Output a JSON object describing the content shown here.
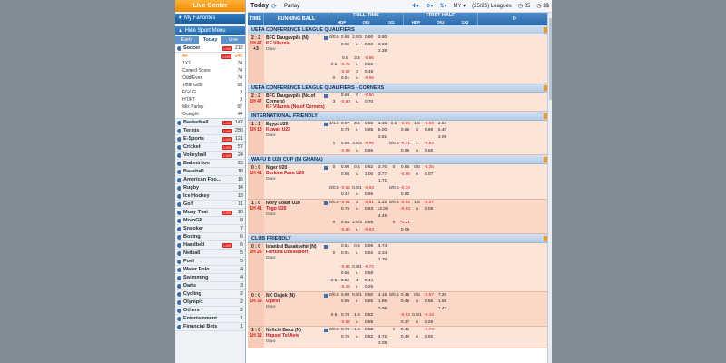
{
  "left": {
    "live_center": "Live Center",
    "my_favorites": "My Favorites",
    "hide_sport_menu": "Hide Sport Menu",
    "tabs": [
      "Early",
      "Today",
      "Live"
    ],
    "soccer": {
      "name": "Soccer",
      "badge": "LIVE",
      "count": "212"
    },
    "soccer_sub": [
      {
        "name": "All",
        "badge": "LIVE",
        "count": "146"
      },
      {
        "name": "1X2",
        "count": "74"
      },
      {
        "name": "Correct Score",
        "count": "74"
      },
      {
        "name": "Odd/Even",
        "count": "74"
      },
      {
        "name": "Total Goal",
        "count": "68"
      },
      {
        "name": "FG/LG",
        "count": "0"
      },
      {
        "name": "HT/FT",
        "count": "0"
      },
      {
        "name": "Mix Parlay",
        "count": "67"
      },
      {
        "name": "Outright",
        "count": "44"
      }
    ],
    "sports": [
      {
        "name": "Basketball",
        "badge": "LIVE",
        "count": "147"
      },
      {
        "name": "Tennis",
        "badge": "LIVE",
        "count": "256"
      },
      {
        "name": "E-Sports",
        "badge": "LIVE",
        "count": "121"
      },
      {
        "name": "Cricket",
        "badge": "LIVE",
        "count": "57"
      },
      {
        "name": "Volleyball",
        "badge": "LIVE",
        "count": "24"
      },
      {
        "name": "Badminton",
        "count": "23"
      },
      {
        "name": "Baseball",
        "count": "18"
      },
      {
        "name": "American Foo...",
        "count": "16"
      },
      {
        "name": "Rugby",
        "count": "14"
      },
      {
        "name": "Ice Hockey",
        "count": "13"
      },
      {
        "name": "Golf",
        "count": "11"
      },
      {
        "name": "Muay Thai",
        "badge": "LIVE",
        "count": "10"
      },
      {
        "name": "MotoGP",
        "count": "8"
      },
      {
        "name": "Snooker",
        "count": "7"
      },
      {
        "name": "Boxing",
        "count": "6"
      },
      {
        "name": "Handball",
        "badge": "LIVE",
        "count": "6"
      },
      {
        "name": "Netball",
        "count": "5"
      },
      {
        "name": "Pool",
        "count": "5"
      },
      {
        "name": "Water Polo",
        "count": "4"
      },
      {
        "name": "Swimming",
        "count": "4"
      },
      {
        "name": "Darts",
        "count": "3"
      },
      {
        "name": "Cycling",
        "count": "2"
      },
      {
        "name": "Olympic",
        "count": "2"
      },
      {
        "name": "Others",
        "count": "2"
      },
      {
        "name": "Entertainment",
        "count": "1"
      },
      {
        "name": "Financial Bets",
        "count": "1"
      }
    ]
  },
  "toolbar": {
    "today": "Today",
    "parlay": "Parlay",
    "my": "MY",
    "leagues": "(25/25) Leagues",
    "a": "85",
    "b": "$$"
  },
  "head": {
    "time": "TIME",
    "running_ball": "RUNNING BALL",
    "full_time": "FULL TIME",
    "first_half": "FIRST HALF",
    "sub": [
      "HDP",
      "O/U",
      "1X2",
      "HDP",
      "O/U",
      "1X2"
    ]
  },
  "leagues": [
    {
      "name": "UEFA CONFERENCE LEAGUE QUALIFIERS",
      "matches": [
        {
          "score": "2 : 2",
          "time": "1H 47",
          "extra": "+3",
          "home": "BFC Daugavpils (N)",
          "away": "KF Vllaznia",
          "draw": "Draw",
          "lines": [
            [
              "0/0.5",
              "0.88",
              "2.5/3",
              "0.90",
              "3.80",
              "",
              "",
              "",
              "",
              ""
            ],
            [
              "",
              "0.96",
              "u",
              "0.92",
              "2.28",
              "",
              "",
              "",
              "",
              ""
            ],
            [
              "",
              "",
              "",
              "",
              "2.38",
              "",
              "",
              "",
              "",
              ""
            ],
            [
              "",
              "0.5",
              "3.5",
              "-0.86",
              "",
              "",
              "",
              "",
              "",
              ""
            ],
            [
              "0.5",
              "-0.75",
              "u",
              "0.66",
              "",
              "",
              "",
              "",
              "",
              ""
            ],
            [
              "",
              "-0.67",
              "3",
              "0.48",
              "",
              "",
              "",
              "",
              "",
              ""
            ],
            [
              "0",
              "0.51",
              "u",
              "-0.66",
              "",
              "",
              "",
              "",
              "",
              ""
            ]
          ]
        }
      ]
    },
    {
      "name": "UEFA CONFERENCE LEAGUE QUALIFIERS - CORNERS",
      "matches": [
        {
          "score": "2 : 2",
          "time": "1H 47",
          "extra": "",
          "home": "BFC Daugavpils (No.of Corners)",
          "away": "KF Vllaznia (No.of Corners)",
          "draw": "",
          "lines": [
            [
              "",
              "0.68",
              "9",
              "-0.90",
              "",
              "",
              "",
              "",
              "",
              ""
            ],
            [
              "3",
              "-0.90",
              "u",
              "0.70",
              "",
              "",
              "",
              "",
              "",
              ""
            ]
          ]
        }
      ]
    },
    {
      "name": "INTERNATIONAL FRIENDLY",
      "matches": [
        {
          "score": "1 : 1",
          "time": "1H 13",
          "extra": "",
          "home": "Egypt U20",
          "away": "Kuwait U23",
          "draw": "Draw",
          "lines": [
            [
              "1/1.5",
              "0.97",
              "3.5",
              "0.85",
              "1.38",
              "0.5",
              "-0.96",
              "1.5",
              "-0.99",
              "2.84"
            ],
            [
              "",
              "0.73",
              "u",
              "0.85",
              "6.00",
              "",
              "0.66",
              "u",
              "0.89",
              "5.40"
            ],
            [
              "",
              "",
              "",
              "",
              "3.81",
              "",
              "",
              "",
              "",
              "2.09"
            ],
            [
              "1",
              "0.69",
              "3.5/3",
              "-0.95",
              "",
              "0/0.5",
              "-0.71",
              "1",
              "-0.84",
              ""
            ],
            [
              "",
              "-0.99",
              "u",
              "0.65",
              "",
              "",
              "0.95",
              "u",
              "0.65",
              ""
            ]
          ]
        }
      ]
    },
    {
      "name": "WAFU B U20 CUP (IN GHANA)",
      "matches": [
        {
          "score": "0 : 0",
          "time": "1H 41",
          "extra": "",
          "home": "Niger U20",
          "away": "Burkina Faso U20",
          "draw": "Draw",
          "lines": [
            [
              "0",
              "0.90",
              "0.5",
              "0.82",
              "3.70",
              "0",
              "0.65",
              "0.5",
              "-0.25",
              ""
            ],
            [
              "",
              "0.94",
              "u",
              "1.00",
              "3.77",
              "",
              "-0.96",
              "u",
              "0.07",
              ""
            ],
            [
              "",
              "",
              "",
              "",
              "1.71",
              "",
              "",
              "",
              "",
              ""
            ],
            [
              "0/0.5",
              "-0.52",
              "0.5/1",
              "-0.83",
              "",
              "0/0.5",
              "-0.30",
              "",
              "",
              ""
            ],
            [
              "",
              "0.42",
              "u",
              "0.65",
              "",
              "",
              "0.82",
              "",
              "",
              ""
            ]
          ]
        },
        {
          "score": "1 : 0",
          "time": "1H 41",
          "extra": "",
          "home": "Ivory Coast U20",
          "away": "Togo U20",
          "draw": "Draw",
          "lines": [
            [
              "0/0.5",
              "-0.91",
              "2",
              "-0.81",
              "1.22",
              "0/0.5",
              "-0.82",
              "1.5",
              "-0.27",
              ""
            ],
            [
              "",
              "0.75",
              "u",
              "0.63",
              "13.00",
              "",
              "-0.83",
              "u",
              "0.09",
              ""
            ],
            [
              "",
              "",
              "",
              "",
              "4.45",
              "",
              "",
              "",
              "",
              ""
            ],
            [
              "0",
              "0.64",
              "2.5/3",
              "0.65",
              "",
              "0",
              "-0.21",
              "",
              "",
              ""
            ],
            [
              "",
              "-0.80",
              "u",
              "-0.83",
              "",
              "",
              "0.05",
              "",
              "",
              ""
            ]
          ]
        }
      ]
    },
    {
      "name": "CLUB FRIENDLY",
      "matches": [
        {
          "score": "0 : 0",
          "time": "2H 26",
          "extra": "",
          "home": "Istanbul Basaksehir (N)",
          "away": "Fortuna Dusseldorf",
          "draw": "Draw",
          "lines": [
            [
              "",
              "0.61",
              "0.5",
              "0.96",
              "4.74",
              "",
              "",
              "",
              "",
              ""
            ],
            [
              "0",
              "0.91",
              "u",
              "0.92",
              "3.34",
              "",
              "",
              "",
              "",
              ""
            ],
            [
              "",
              "",
              "",
              "",
              "1.70",
              "",
              "",
              "",
              "",
              ""
            ],
            [
              "",
              "-0.66",
              "0.5/1",
              "-0.72",
              "",
              "",
              "",
              "",
              "",
              ""
            ],
            [
              "",
              "0.56",
              "u",
              "0.58",
              "",
              "",
              "",
              "",
              "",
              ""
            ],
            [
              "0.5",
              "0.52",
              "1",
              "0.44",
              "",
              "",
              "",
              "",
              "",
              ""
            ],
            [
              "",
              "-0.44",
              "u",
              "0.26",
              "",
              "",
              "",
              "",
              "",
              ""
            ]
          ]
        },
        {
          "score": "0 : 0",
          "time": "1H 33",
          "extra": "",
          "home": "NK Osijek (N)",
          "away": "Ujpest",
          "draw": "Draw",
          "lines": [
            [
              "0/0.5",
              "0.99",
              "0.5/1",
              "0.90",
              "4.15",
              "0/0.5",
              "0.45",
              "0.5",
              "-0.67",
              "7.20"
            ],
            [
              "",
              "0.85",
              "u",
              "0.85",
              "1.85",
              "",
              "0.45",
              "u",
              "0.56",
              "1.58"
            ],
            [
              "",
              "",
              "",
              "",
              "2.96",
              "",
              "",
              "",
              "",
              "1.43"
            ],
            [
              "0.5",
              "0.76",
              "1.5",
              "0.82",
              "",
              "",
              "-0.53",
              "0.5/1",
              "-0.44",
              ""
            ],
            [
              "",
              "-0.92",
              "u",
              "0.85",
              "",
              "",
              "0.37",
              "u",
              "0.26",
              ""
            ]
          ]
        },
        {
          "score": "1 : 0",
          "time": "1H 32",
          "extra": "",
          "home": "Neftchi Baku (N)",
          "away": "Hapoel Tel Aviv",
          "draw": "Draw",
          "lines": [
            [
              "0/0.5",
              "0.76",
              "1.5",
              "0.82",
              "",
              "0",
              "0.45",
              "",
              "-0.74",
              ""
            ],
            [
              "",
              "0.76",
              "u",
              "0.82",
              "4.72",
              "",
              "0.40",
              "u",
              "0.92",
              ""
            ],
            [
              "",
              "",
              "",
              "",
              "2.09",
              "",
              "",
              "",
              "",
              ""
            ]
          ]
        }
      ]
    }
  ]
}
